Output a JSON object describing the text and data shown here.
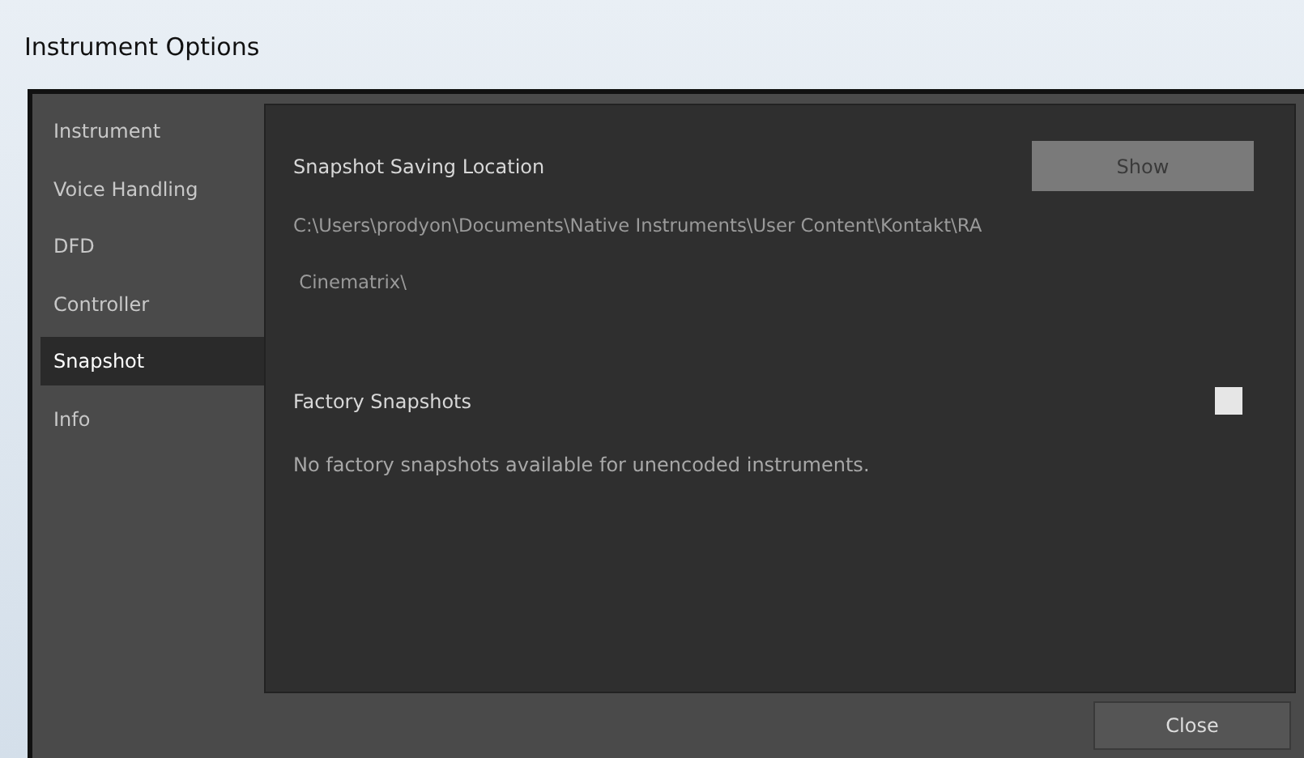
{
  "window": {
    "title": "Instrument Options"
  },
  "sidebar": {
    "items": [
      {
        "label": "Instrument",
        "selected": false
      },
      {
        "label": "Voice Handling",
        "selected": false
      },
      {
        "label": "DFD",
        "selected": false
      },
      {
        "label": "Controller",
        "selected": false
      },
      {
        "label": "Snapshot",
        "selected": true
      },
      {
        "label": "Info",
        "selected": false
      }
    ]
  },
  "snapshot": {
    "saving_location": {
      "heading": "Snapshot Saving Location",
      "button": "Show",
      "path_lines": [
        "C:\\Users\\prodyon\\Documents\\Native Instruments\\User Content\\Kontakt\\RA",
        " Cinematrix\\"
      ]
    },
    "factory": {
      "heading": "Factory Snapshots",
      "checked": false,
      "message": "No factory snapshots available for unencoded instruments."
    }
  },
  "buttons": [
    "Close"
  ]
}
